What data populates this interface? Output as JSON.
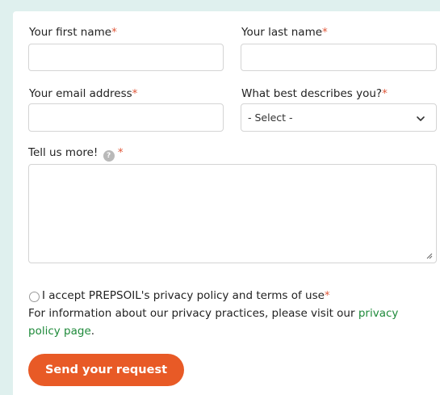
{
  "form": {
    "first_name": {
      "label": "Your first name",
      "required_mark": "*",
      "value": ""
    },
    "last_name": {
      "label": "Your last name",
      "required_mark": "*",
      "value": ""
    },
    "email": {
      "label": "Your email address",
      "required_mark": "*",
      "value": ""
    },
    "describe": {
      "label": "What best describes you?",
      "required_mark": "*",
      "selected": "- Select -"
    },
    "tell_more": {
      "label": "Tell us more!",
      "help_glyph": "?",
      "required_mark": "*"
    },
    "privacy": {
      "accept_label": "I accept PREPSOIL's privacy policy and terms of use",
      "required_mark": "*",
      "info_text": "For information about our privacy practices, please visit our ",
      "link_text": "privacy policy page",
      "info_end": "."
    },
    "submit_label": "Send your request"
  },
  "colors": {
    "background": "#dff0ee",
    "accent": "#e85a26",
    "link": "#1e8a3a",
    "required": "#e0583a"
  }
}
